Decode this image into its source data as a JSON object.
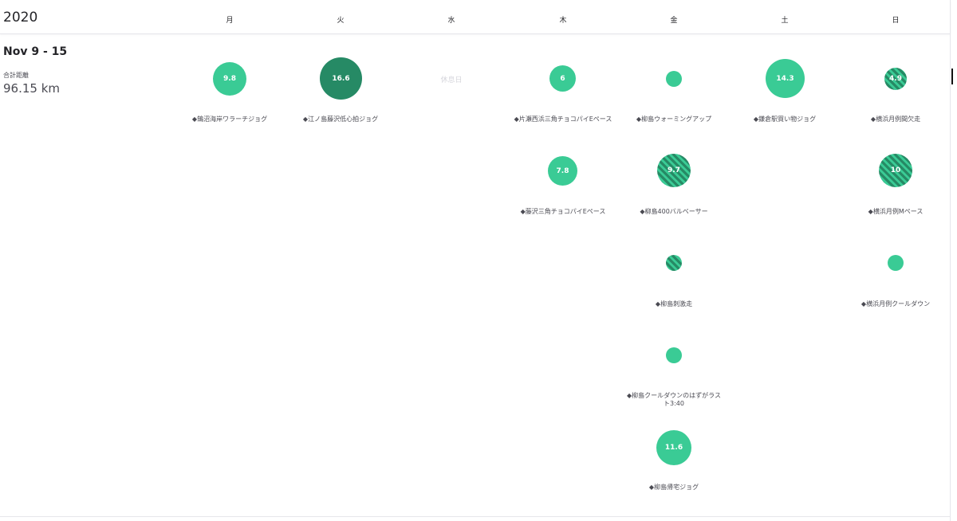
{
  "header": {
    "year": "2020",
    "days": [
      "月",
      "火",
      "水",
      "木",
      "金",
      "土",
      "日"
    ]
  },
  "week": {
    "range": "Nov 9 - 15",
    "total_label": "合計距離",
    "total_value": "96.15 km",
    "rest_label": "休息日"
  },
  "colors": {
    "accent": "#3acb95",
    "accent_dark": "#268a65",
    "text": "#242428"
  },
  "activities": {
    "mon_1": {
      "distance": "9.8",
      "title": "◆鵠沼海岸ワラーチジョグ",
      "style": "solid"
    },
    "tue_1": {
      "distance": "16.6",
      "title": "◆江ノ島藤沢低心拍ジョグ",
      "style": "dark"
    },
    "thu_1": {
      "distance": "6",
      "title": "◆片瀬西浜三角チョコパイEペース",
      "style": "solid"
    },
    "thu_2": {
      "distance": "7.8",
      "title": "◆藤沢三角チョコパイEペース",
      "style": "solid"
    },
    "fri_1": {
      "distance": "",
      "title": "◆柳島ウォーミングアップ",
      "style": "solid"
    },
    "fri_2": {
      "distance": "9.7",
      "title": "◆柳島400バルベーサー",
      "style": "striped"
    },
    "fri_3": {
      "distance": "",
      "title": "◆柳島刺激走",
      "style": "striped"
    },
    "fri_4": {
      "distance": "",
      "title": "◆柳島クールダウンのはずがラスト3:40",
      "style": "solid"
    },
    "fri_5": {
      "distance": "11.6",
      "title": "◆柳島帰宅ジョグ",
      "style": "solid"
    },
    "sat_1": {
      "distance": "14.3",
      "title": "◆鎌倉駅買い物ジョグ",
      "style": "solid"
    },
    "sun_1": {
      "distance": "4.9",
      "title": "◆横浜月例間欠走",
      "style": "striped"
    },
    "sun_2": {
      "distance": "10",
      "title": "◆横浜月例Mペース",
      "style": "striped"
    },
    "sun_3": {
      "distance": "",
      "title": "◆横浜月例クールダウン",
      "style": "solid"
    }
  }
}
